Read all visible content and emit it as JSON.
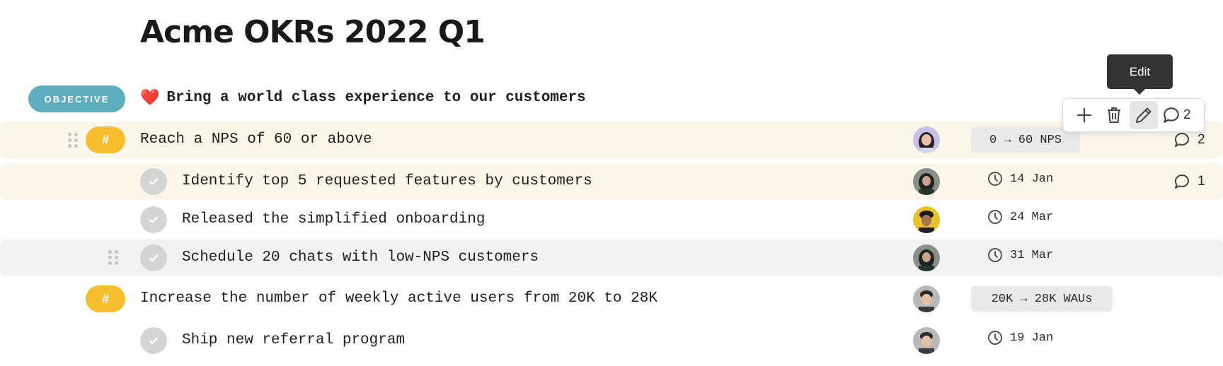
{
  "page": {
    "title": "Acme OKRs 2022 Q1"
  },
  "objective": {
    "badge": "OBJECTIVE",
    "emoji": "❤️",
    "text": "Bring a world class experience to our customers"
  },
  "tooltip": {
    "label": "Edit"
  },
  "toolbar": {
    "icons": [
      "plus-icon",
      "trash-icon",
      "pencil-icon",
      "comment-icon"
    ],
    "comment_count": "2"
  },
  "rows": [
    {
      "kind": "key-result",
      "badge": "#",
      "text": "Reach a NPS of 60 or above",
      "metric": "0 → 60 NPS",
      "comments": "2",
      "avatar": "avatar-woman-purple"
    },
    {
      "kind": "task",
      "text": "Identify top 5 requested features by customers",
      "date": "14 Jan",
      "comments": "1",
      "avatar": "avatar-man-hijab"
    },
    {
      "kind": "task",
      "text": "Released the simplified onboarding",
      "date": "24 Mar",
      "avatar": "avatar-man-yellow"
    },
    {
      "kind": "task",
      "text": "Schedule 20 chats with low-NPS customers",
      "date": "31 Mar",
      "avatar": "avatar-man-hijab"
    },
    {
      "kind": "key-result",
      "badge": "#",
      "text": "Increase the number of weekly active users from 20K to 28K",
      "metric": "20K → 28K WAUs",
      "avatar": "avatar-man-gray"
    },
    {
      "kind": "task",
      "text": "Ship new referral program",
      "date": "19 Jan",
      "avatar": "avatar-man-gray"
    }
  ],
  "colors": {
    "objective_badge": "#5eaebd",
    "key_result_badge": "#f6be2e",
    "highlight_warm": "#faf6ea",
    "highlight_gray": "#f2f2f2",
    "tooltip_bg": "#333333"
  }
}
